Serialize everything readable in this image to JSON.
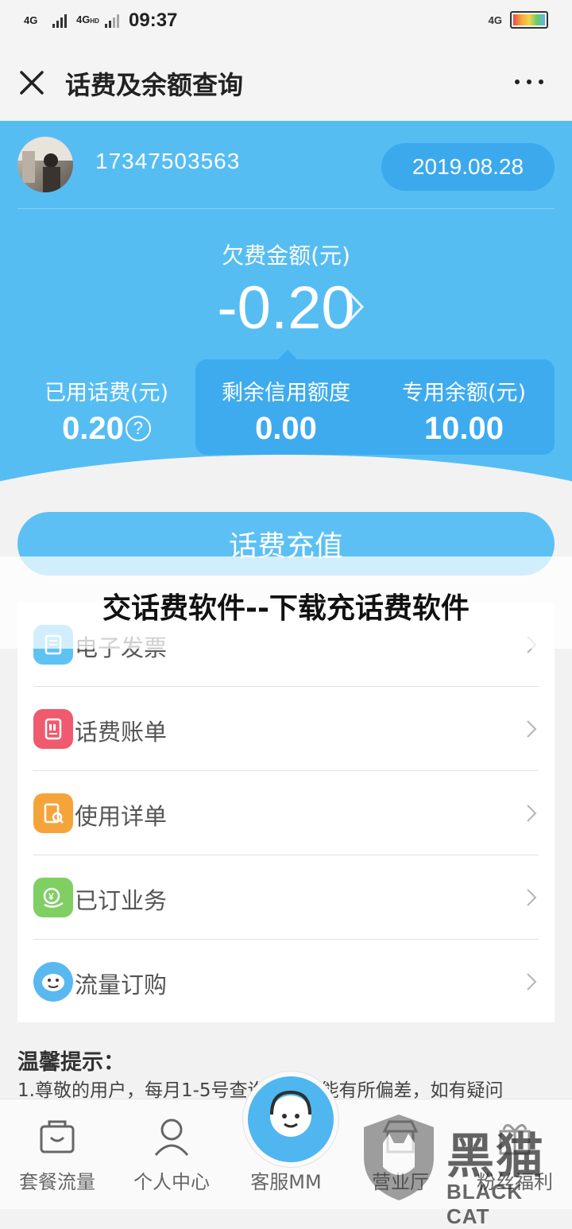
{
  "status_bar": {
    "net1": "4G",
    "net2": "4G",
    "net2_suffix": "HD",
    "time": "09:37",
    "net_right": "4G"
  },
  "nav": {
    "title": "话费及余额查询"
  },
  "account": {
    "phone": "17347503563",
    "date": "2019.08.28"
  },
  "owed": {
    "label": "欠费金额(元)",
    "amount": "-0.20"
  },
  "stats": [
    {
      "label": "已用话费(元)",
      "value": "0.20"
    },
    {
      "label": "剩余信用额度",
      "value": "0.00"
    },
    {
      "label": "专用余额(元)",
      "value": "10.00"
    }
  ],
  "recharge_label": "话费充值",
  "overlay_title": "交话费软件--下载充话费软件",
  "menu": [
    {
      "label": "电子发票",
      "icon": "invoice-icon",
      "color": "#5ec3f3"
    },
    {
      "label": "话费账单",
      "icon": "bill-icon",
      "color": "#f05a6e"
    },
    {
      "label": "使用详单",
      "icon": "detail-list-icon",
      "color": "#f5a43c"
    },
    {
      "label": "已订业务",
      "icon": "subscribed-service-icon",
      "color": "#7fcf63"
    },
    {
      "label": "流量订购",
      "icon": "data-order-icon",
      "color": "#5ab8f0"
    }
  ],
  "tips": {
    "title": "温馨提示：",
    "text": "1.尊敬的用户，每月1-5号查询结果可能有所偏差，如有疑问"
  },
  "tabs": [
    {
      "label": "套餐流量",
      "icon": "package-icon"
    },
    {
      "label": "个人中心",
      "icon": "person-icon"
    },
    {
      "label": "客服MM",
      "icon": "customer-service-icon"
    },
    {
      "label": "营业厅",
      "icon": "store-icon"
    },
    {
      "label": "粉丝福利",
      "icon": "gift-icon"
    }
  ],
  "watermark": {
    "cn": "黑猫",
    "en": "BLACK CAT"
  }
}
